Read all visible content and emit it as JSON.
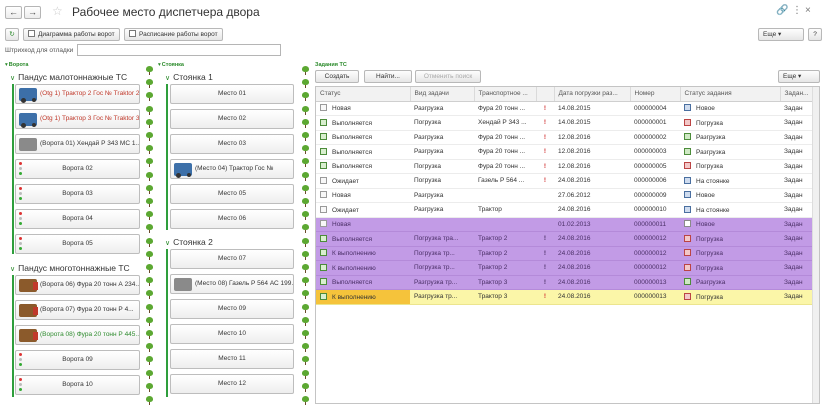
{
  "header": {
    "title": "Рабочее место диспетчера двора",
    "back_label": "←",
    "forward_label": "→",
    "more_label": "Еще",
    "help_label": "?"
  },
  "toolbar": {
    "refresh_label": "↻",
    "diagram_label": "Диаграмма работы ворот",
    "schedule_label": "Расписание работы ворот",
    "more_label": "Еще"
  },
  "barcode": {
    "label": "Штрихкод для отладки",
    "value": ""
  },
  "gates": {
    "section_title": "Ворота",
    "group1_title": "Пандус малотоннажные ТС",
    "group1_items": [
      {
        "label": "(Otg 1) Трактор 2 Гос № Traktor 2",
        "icon": "tractor-icon",
        "color": "red"
      },
      {
        "label": "(Otg 1) Трактор 3 Гос № Traktor 3",
        "icon": "tractor-icon",
        "color": "red"
      },
      {
        "label": "(Ворота 01) Хендай Р 343 МС 1...",
        "icon": "car-icon",
        "color": "normal"
      },
      {
        "label": "Ворота 02",
        "icon": "signal-icon",
        "color": "normal"
      },
      {
        "label": "Ворота 03",
        "icon": "signal-icon",
        "color": "normal"
      },
      {
        "label": "Ворота 04",
        "icon": "signal-icon",
        "color": "normal"
      },
      {
        "label": "Ворота 05",
        "icon": "signal-icon",
        "color": "normal"
      }
    ],
    "group2_title": "Пандус многотоннажные ТС",
    "group2_items": [
      {
        "label": "(Ворота 06) Фура 20 тонн А 234...",
        "icon": "truck-icon",
        "color": "normal"
      },
      {
        "label": "(Ворота 07) Фура 20 тонн  Р 4...",
        "icon": "truck-icon",
        "color": "normal"
      },
      {
        "label": "(Ворота 08) Фура 20 тонн Р 445...",
        "icon": "truck-icon",
        "color": "green"
      },
      {
        "label": "Ворота 09",
        "icon": "signal-icon",
        "color": "normal"
      },
      {
        "label": "Ворота 10",
        "icon": "signal-icon",
        "color": "normal"
      }
    ]
  },
  "parking": {
    "section_title": "Стоянка",
    "group1_title": "Стоянка 1",
    "group1_items": [
      {
        "label": "Место 01",
        "icon": ""
      },
      {
        "label": "Место 02",
        "icon": ""
      },
      {
        "label": "Место 03",
        "icon": ""
      },
      {
        "label": "(Место 04) Трактор Гос №",
        "icon": "tractor-icon"
      },
      {
        "label": "Место 05",
        "icon": ""
      },
      {
        "label": "Место 06",
        "icon": ""
      }
    ],
    "group2_title": "Стоянка 2",
    "group2_items": [
      {
        "label": "Место 07",
        "icon": ""
      },
      {
        "label": "(Место 08) Газель Р 564 АС 199...",
        "icon": "van-icon"
      },
      {
        "label": "Место 09",
        "icon": ""
      },
      {
        "label": "Место 10",
        "icon": ""
      },
      {
        "label": "Место 11",
        "icon": ""
      },
      {
        "label": "Место 12",
        "icon": ""
      }
    ]
  },
  "tasks": {
    "section_title": "Задания ТС",
    "create_label": "Создать",
    "find_label": "Найти...",
    "cancel_search_label": "Отменить поиск",
    "more_label": "Еще",
    "columns": [
      "Статус",
      "Вид задачи",
      "Транспортное ...",
      "",
      "Дата погрузки раз...",
      "Номер",
      "Статус задания",
      "Задан..."
    ],
    "rows": [
      {
        "status": "Новая",
        "type": "Разгрузка",
        "vehicle": "Фура 20 тонн ...",
        "flag": "!",
        "date": "14.08.2015",
        "number": "000000004",
        "task_status": "Новое",
        "extra": "Задан",
        "style": "",
        "sicon": "blu"
      },
      {
        "status": "Выполняется",
        "type": "Погрузка",
        "vehicle": "Хендай Р 343 ...",
        "flag": "!",
        "date": "14.08.2015",
        "number": "000000001",
        "task_status": "Погрузка",
        "extra": "Задан",
        "style": "",
        "sicon": "red"
      },
      {
        "status": "Выполняется",
        "type": "Разгрузка",
        "vehicle": "Фура 20 тонн ...",
        "flag": "!",
        "date": "12.08.2016",
        "number": "000000002",
        "task_status": "Разгрузка",
        "extra": "Задан",
        "style": "",
        "sicon": "grn"
      },
      {
        "status": "Выполняется",
        "type": "Разгрузка",
        "vehicle": "Фура 20 тонн ...",
        "flag": "!",
        "date": "12.08.2016",
        "number": "000000003",
        "task_status": "Разгрузка",
        "extra": "Задан",
        "style": "",
        "sicon": "grn"
      },
      {
        "status": "Выполняется",
        "type": "Погрузка",
        "vehicle": "Фура 20 тонн ...",
        "flag": "!",
        "date": "12.08.2016",
        "number": "000000005",
        "task_status": "Погрузка",
        "extra": "Задан",
        "style": "",
        "sicon": "red"
      },
      {
        "status": "Ожидает",
        "type": "Погрузка",
        "vehicle": "Газель Р 564 ...",
        "flag": "!",
        "date": "24.08.2016",
        "number": "000000006",
        "task_status": "На стоянке",
        "extra": "Задан",
        "style": "",
        "sicon": "blu"
      },
      {
        "status": "Новая",
        "type": "Разгрузка",
        "vehicle": "",
        "flag": "",
        "date": "27.06.2012",
        "number": "000000009",
        "task_status": "Новое",
        "extra": "Задан",
        "style": "",
        "sicon": "blu"
      },
      {
        "status": "Ожидает",
        "type": "Разгрузка",
        "vehicle": "Трактор",
        "flag": "",
        "date": "24.08.2016",
        "number": "000000010",
        "task_status": "На стоянке",
        "extra": "Задан",
        "style": "",
        "sicon": "blu"
      },
      {
        "status": "Новая",
        "type": "",
        "vehicle": "",
        "flag": "",
        "date": "01.02.2013",
        "number": "000000011",
        "task_status": "Новое",
        "extra": "Задан",
        "style": "purple",
        "sicon": ""
      },
      {
        "status": "Выполняется",
        "type": "Погрузка тра...",
        "vehicle": "Трактор 2",
        "flag": "!",
        "date": "24.08.2016",
        "number": "000000012",
        "task_status": "Погрузка",
        "extra": "Задан",
        "style": "purple",
        "sicon": "red"
      },
      {
        "status": "К выполнению",
        "type": "Погрузка тр...",
        "vehicle": "Трактор 2",
        "flag": "!",
        "date": "24.08.2016",
        "number": "000000012",
        "task_status": "Погрузка",
        "extra": "Задан",
        "style": "purple",
        "sicon": "red"
      },
      {
        "status": "К выполнению",
        "type": "Погрузка тр...",
        "vehicle": "Трактор 2",
        "flag": "!",
        "date": "24.08.2016",
        "number": "000000012",
        "task_status": "Погрузка",
        "extra": "Задан",
        "style": "purple",
        "sicon": "red"
      },
      {
        "status": "Выполняется",
        "type": "Разгрузка тр...",
        "vehicle": "Трактор 3",
        "flag": "!",
        "date": "24.08.2016",
        "number": "000000013",
        "task_status": "Разгрузка",
        "extra": "Задан",
        "style": "purple",
        "sicon": "grn"
      },
      {
        "status": "К выполнению",
        "type": "Разгрузка тр...",
        "vehicle": "Трактор 3",
        "flag": "!",
        "date": "24.08.2016",
        "number": "000000013",
        "task_status": "Погрузка",
        "extra": "Задан",
        "style": "yellow",
        "sicon": "red"
      }
    ]
  },
  "colors": {
    "accent_green": "#2e9e3c",
    "row_purple": "#c29be6",
    "row_yellow": "#fbf6a8",
    "selected": "#f5c33b"
  }
}
